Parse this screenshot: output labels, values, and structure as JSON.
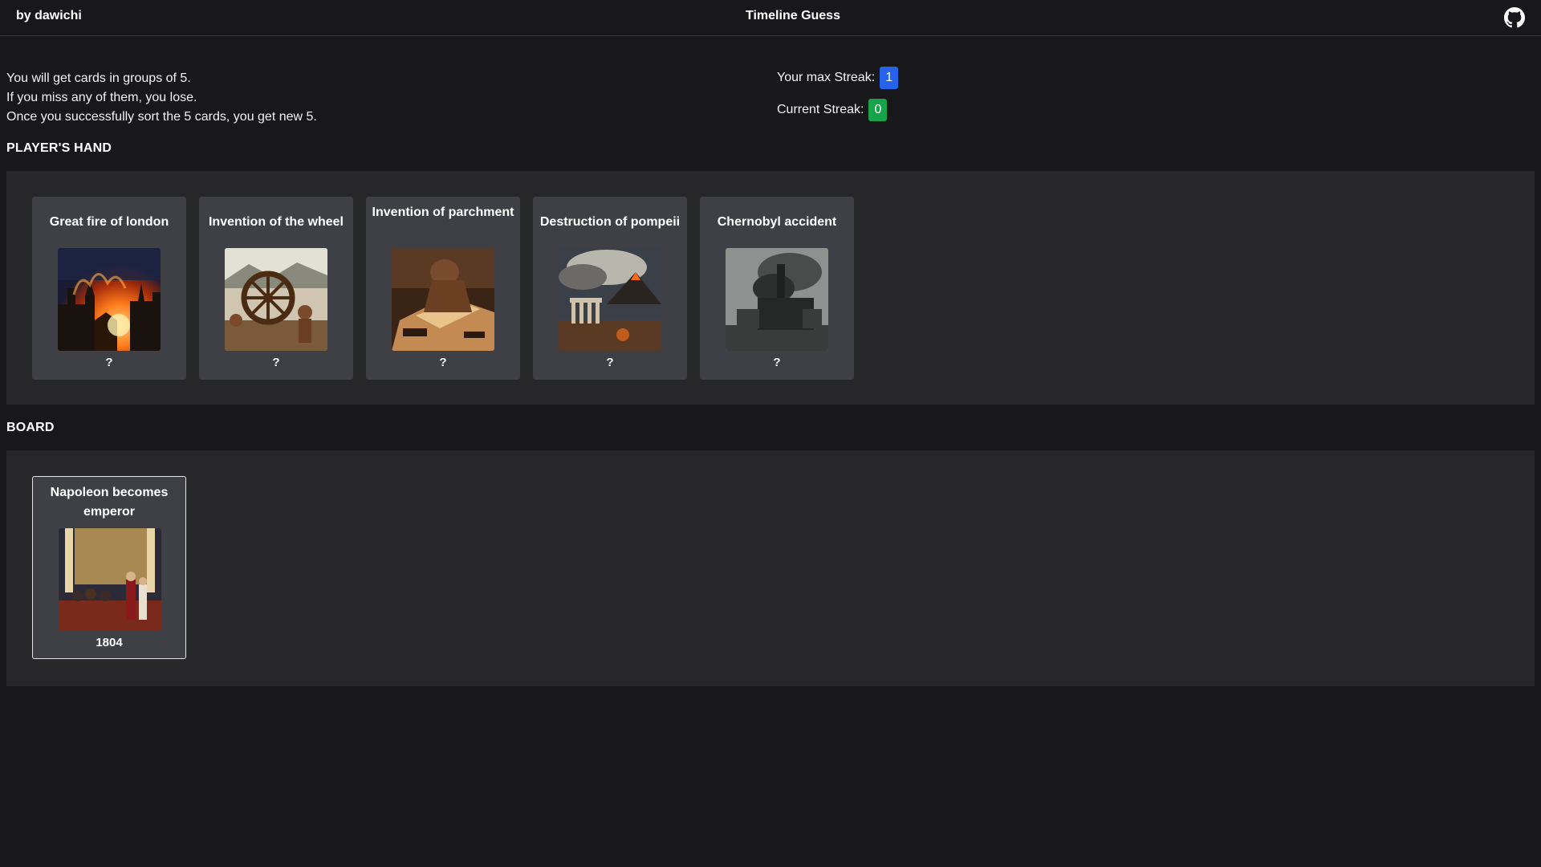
{
  "header": {
    "author": "by dawichi",
    "title": "Timeline Guess",
    "github_icon": "github-icon"
  },
  "rules": [
    "You will get cards in groups of 5.",
    "If you miss any of them, you lose.",
    "Once you successfully sort the 5 cards, you get new 5."
  ],
  "streaks": {
    "max_label": "Your max Streak:",
    "max_value": "1",
    "max_color": "#2563eb",
    "current_label": "Current Streak:",
    "current_value": "0",
    "current_color": "#16a34a"
  },
  "hand": {
    "label": "PLAYER'S HAND",
    "cards": [
      {
        "title": "Great fire of london",
        "year": "?"
      },
      {
        "title": "Invention of the wheel",
        "year": "?"
      },
      {
        "title": "Invention of parchment",
        "year": "?"
      },
      {
        "title": "Destruction of pompeii",
        "year": "?"
      },
      {
        "title": "Chernobyl accident",
        "year": "?"
      }
    ]
  },
  "board": {
    "label": "BOARD",
    "cards": [
      {
        "title": "Napoleon becomes emperor",
        "year": "1804"
      }
    ]
  }
}
